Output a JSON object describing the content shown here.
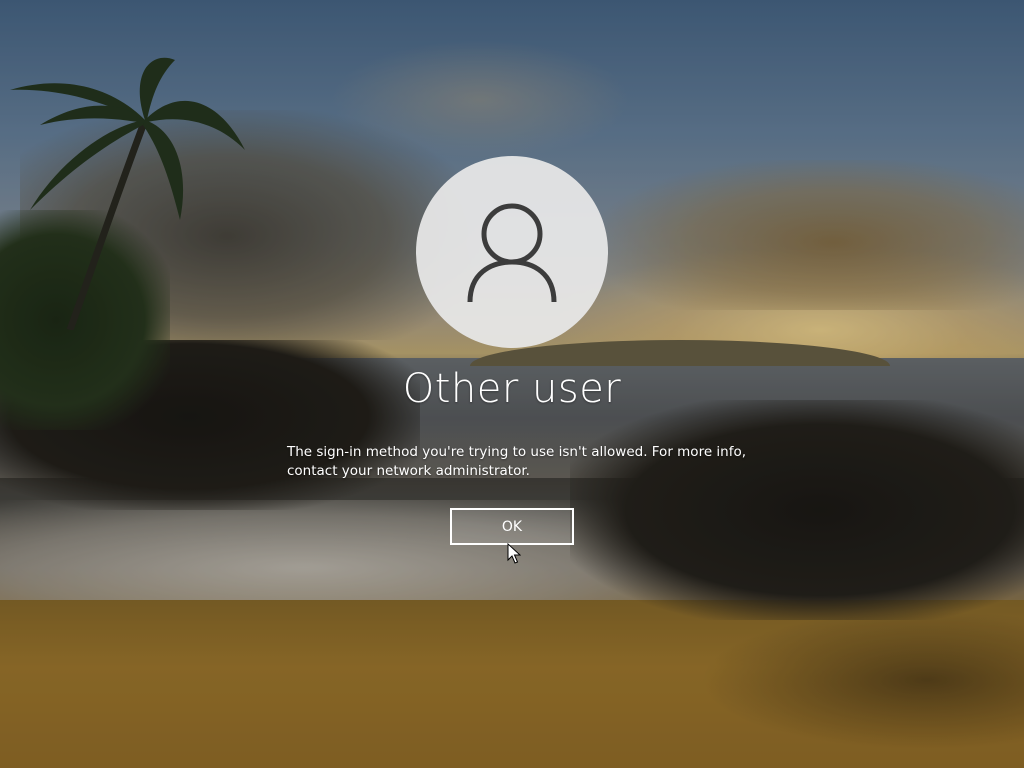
{
  "lock_screen": {
    "user_name": "Other user",
    "message_line_1": "The sign-in method you're trying to use isn't allowed. For more info,",
    "message_line_2": "contact your network administrator.",
    "ok_label": "OK"
  },
  "icons": {
    "avatar": "user-silhouette-icon",
    "cursor": "mouse-pointer-icon"
  },
  "colors": {
    "text": "#ffffff",
    "avatar_background": "#e8e8e8",
    "avatar_glyph": "#3c3c3c",
    "button_border": "#ffffff"
  }
}
